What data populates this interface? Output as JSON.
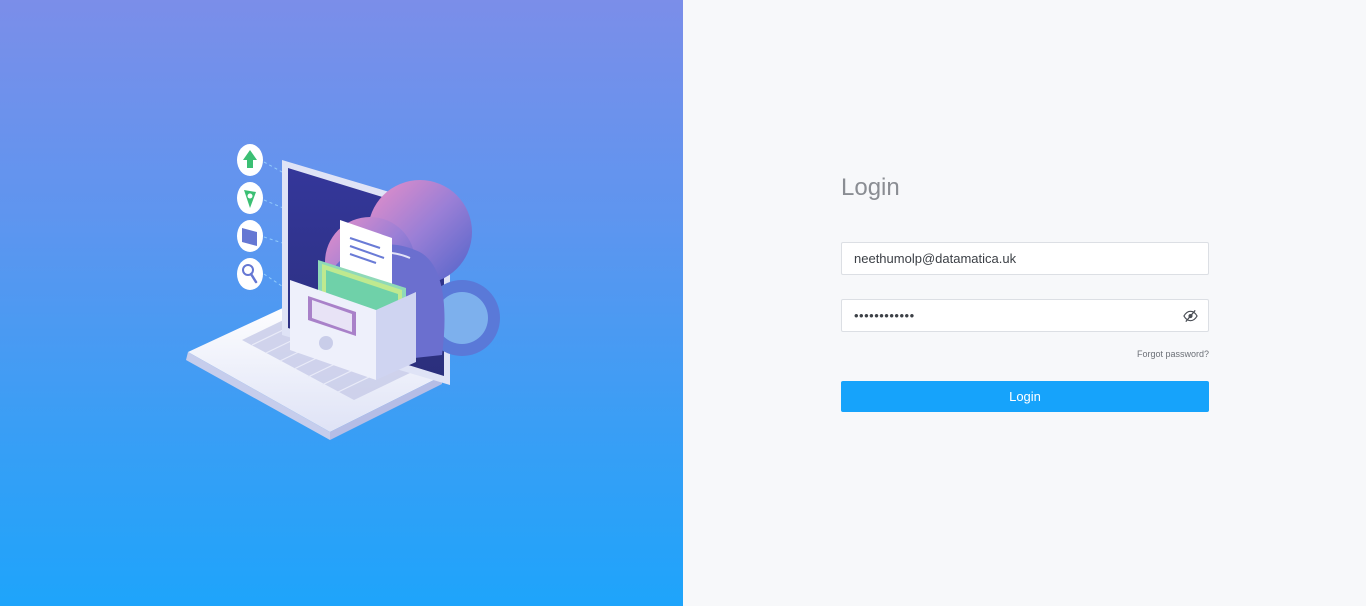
{
  "login": {
    "title": "Login",
    "email_value": "neethumolp@datamatica.uk",
    "password_value": "••••••••••••",
    "forgot_password": "Forgot password?",
    "submit_label": "Login"
  },
  "icons": {
    "password_toggle": "eye-slash-icon",
    "illustration_side_icons": [
      "upload-arrow-icon",
      "location-pin-icon",
      "folder-icon",
      "search-icon"
    ]
  },
  "colors": {
    "accent": "#16a3fb",
    "left_gradient_top": "#7b8ee9",
    "left_gradient_bottom": "#1ea4fb",
    "right_background": "#f7f8fa",
    "title_text": "#8a8d93"
  }
}
